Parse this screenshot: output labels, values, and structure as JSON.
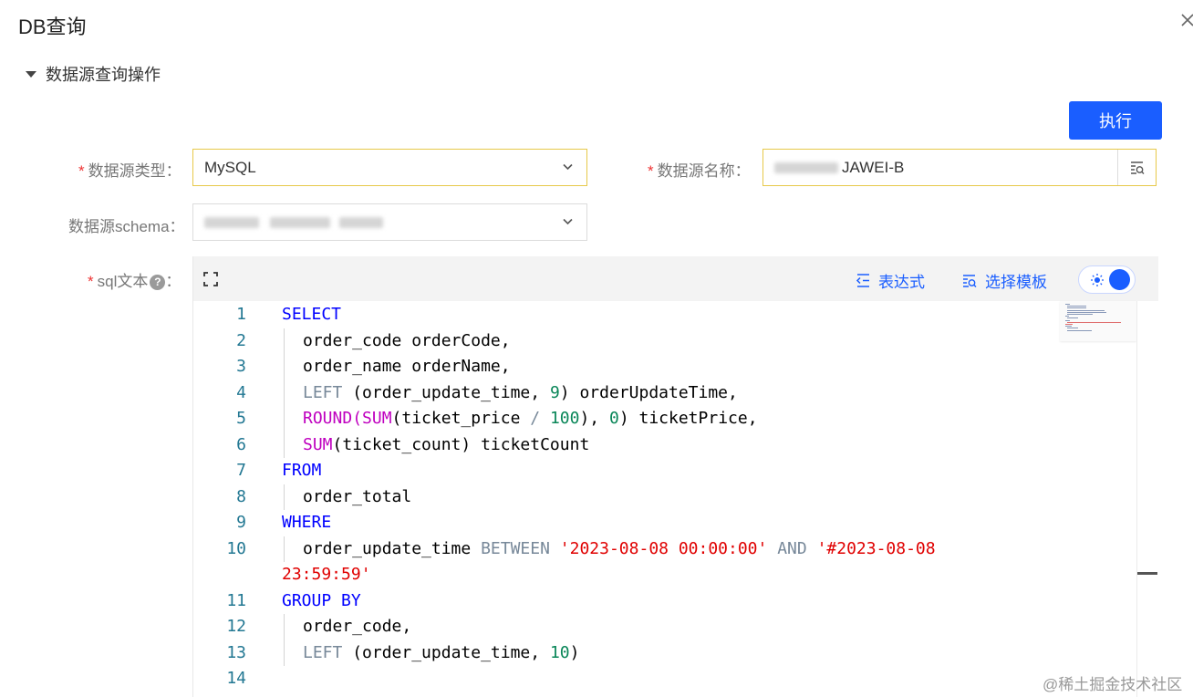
{
  "dialog": {
    "title": "DB查询"
  },
  "section": {
    "title": "数据源查询操作"
  },
  "toolbar": {
    "execute_label": "执行"
  },
  "form": {
    "datasource_type": {
      "label": "数据源类型",
      "required": "*",
      "value": "MySQL"
    },
    "datasource_name": {
      "label": "数据源名称",
      "required": "*",
      "value_suffix": "JAWEI-B"
    },
    "datasource_schema": {
      "label": "数据源schema"
    },
    "sql_text": {
      "label": "sql文本",
      "required": "*",
      "help": "?"
    },
    "label_suffix": "："
  },
  "editor": {
    "expression_label": "表达式",
    "template_label": "选择模板",
    "lines": [
      {
        "no": "1",
        "tokens": [
          [
            "kw",
            "SELECT"
          ]
        ]
      },
      {
        "no": "2",
        "indent": true,
        "tokens": [
          [
            "",
            "order_code orderCode,"
          ]
        ]
      },
      {
        "no": "3",
        "indent": true,
        "tokens": [
          [
            "",
            "order_name orderName,"
          ]
        ]
      },
      {
        "no": "4",
        "indent": true,
        "tokens": [
          [
            "op",
            "LEFT"
          ],
          [
            "",
            " (order_update_time, "
          ],
          [
            "num",
            "9"
          ],
          [
            "",
            ") orderUpdateTime,"
          ]
        ]
      },
      {
        "no": "5",
        "indent": true,
        "tokens": [
          [
            "fn",
            "ROUND"
          ],
          [
            "fn",
            "("
          ],
          [
            "fn",
            "SUM"
          ],
          [
            "",
            "(ticket_price "
          ],
          [
            "op",
            "/"
          ],
          [
            "",
            " "
          ],
          [
            "num",
            "100"
          ],
          [
            "",
            "), "
          ],
          [
            "num",
            "0"
          ],
          [
            "",
            ") ticketPrice,"
          ]
        ]
      },
      {
        "no": "6",
        "indent": true,
        "tokens": [
          [
            "fn",
            "SUM"
          ],
          [
            "",
            "(ticket_count) ticketCount"
          ]
        ]
      },
      {
        "no": "7",
        "tokens": [
          [
            "kw",
            "FROM"
          ]
        ]
      },
      {
        "no": "8",
        "indent": true,
        "tokens": [
          [
            "",
            "order_total"
          ]
        ]
      },
      {
        "no": "9",
        "tokens": [
          [
            "kw",
            "WHERE"
          ]
        ]
      },
      {
        "no": "10",
        "indent": true,
        "tokens": [
          [
            "",
            "order_update_time "
          ],
          [
            "op",
            "BETWEEN"
          ],
          [
            "",
            " "
          ],
          [
            "str",
            "'2023-08-08 00:00:00'"
          ],
          [
            "",
            " "
          ],
          [
            "op",
            "AND"
          ],
          [
            "",
            " "
          ],
          [
            "str",
            "'#2023-08-08"
          ]
        ]
      },
      {
        "no": "",
        "tokens": [
          [
            "str",
            "23:59:59'"
          ]
        ]
      },
      {
        "no": "11",
        "tokens": [
          [
            "kw",
            "GROUP BY"
          ]
        ]
      },
      {
        "no": "12",
        "indent": true,
        "tokens": [
          [
            "",
            "order_code,"
          ]
        ]
      },
      {
        "no": "13",
        "indent": true,
        "tokens": [
          [
            "op",
            "LEFT"
          ],
          [
            "",
            " (order_update_time, "
          ],
          [
            "num",
            "10"
          ],
          [
            "",
            ")"
          ]
        ]
      },
      {
        "no": "14",
        "tokens": []
      }
    ]
  },
  "watermark": "@稀土掘金技术社区",
  "colors": {
    "accent": "#1a5eff",
    "highlight_border": "#e7c94a",
    "required": "#e33333"
  }
}
